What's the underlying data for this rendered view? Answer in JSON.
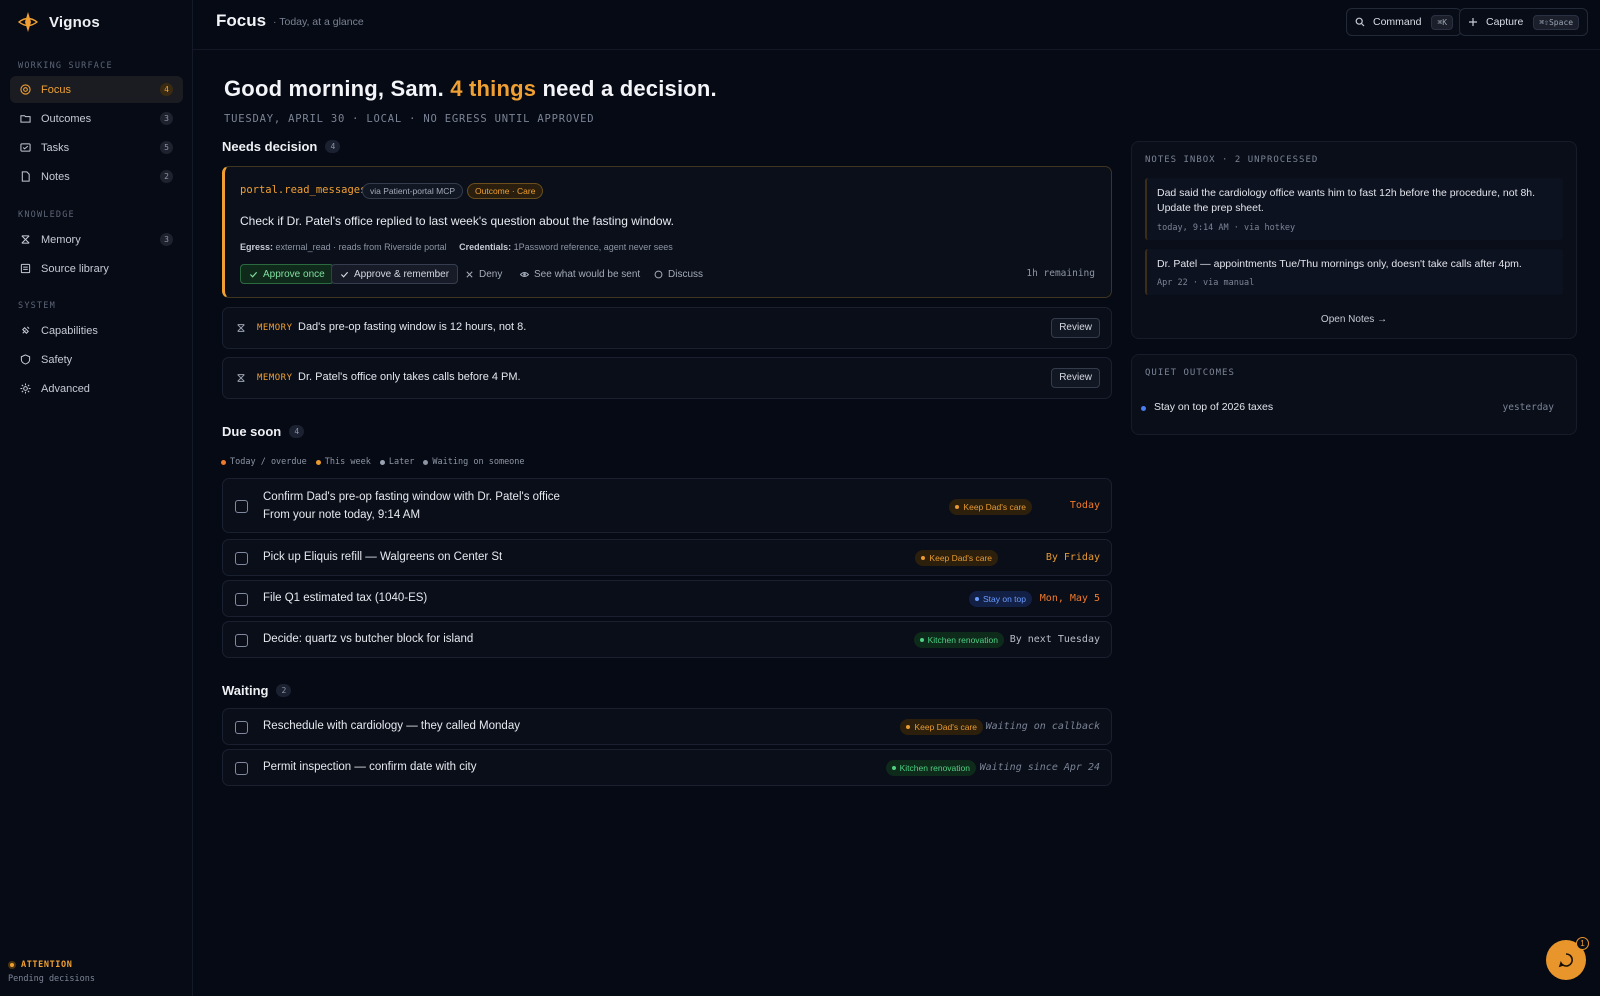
{
  "app": {
    "name": "Vignos"
  },
  "sidebar": {
    "sections": [
      {
        "label": "Working surface",
        "items": [
          {
            "label": "Focus",
            "count": "4",
            "icon": "target-icon",
            "active": true
          },
          {
            "label": "Outcomes",
            "count": "3",
            "icon": "folder-icon"
          },
          {
            "label": "Tasks",
            "count": "5",
            "icon": "checklist-icon"
          },
          {
            "label": "Notes",
            "count": "2",
            "icon": "document-icon"
          }
        ]
      },
      {
        "label": "Knowledge",
        "items": [
          {
            "label": "Memory",
            "count": "3",
            "icon": "memory-icon"
          },
          {
            "label": "Source library",
            "count": "",
            "icon": "library-icon"
          }
        ]
      },
      {
        "label": "System",
        "items": [
          {
            "label": "Capabilities",
            "count": "",
            "icon": "plug-icon"
          },
          {
            "label": "Safety",
            "count": "",
            "icon": "shield-icon"
          },
          {
            "label": "Advanced",
            "count": "",
            "icon": "gear-icon"
          }
        ]
      }
    ],
    "attention": {
      "title": "ATTENTION",
      "subtitle": "Pending decisions"
    }
  },
  "header": {
    "title": "Focus",
    "subtitle": "· Today, at a glance",
    "command": {
      "label": "Command",
      "shortcut": "⌘K"
    },
    "capture": {
      "label": "Capture",
      "shortcut": "⌘⇧Space"
    }
  },
  "greeting": {
    "prefix": "Good morning, Sam.",
    "highlight": "4 things",
    "suffix": "need a decision.",
    "dateline": "TUESDAY, APRIL 30 · LOCAL · NO EGRESS UNTIL APPROVED"
  },
  "needs_decision": {
    "title": "Needs decision",
    "count": "4",
    "primary": {
      "tool": "portal.read_messages",
      "via": "via Patient-portal MCP",
      "outcome": "Outcome · Care",
      "question": "Check if Dr. Patel's office replied to last week's question about the fasting window.",
      "egress_label": "Egress:",
      "egress_value": "external_read · reads from Riverside portal",
      "credentials_label": "Credentials:",
      "credentials_value": "1Password reference, agent never sees",
      "actions": {
        "approve_once": "Approve once",
        "approve_remember": "Approve & remember",
        "deny": "Deny",
        "preview": "See what would be sent",
        "discuss": "Discuss"
      },
      "remaining": "1h remaining"
    },
    "memories": [
      {
        "tag": "MEMORY",
        "text": "Dad's pre-op fasting window is 12 hours, not 8.",
        "action": "Review"
      },
      {
        "tag": "MEMORY",
        "text": "Dr. Patel's office only takes calls before 4 PM.",
        "action": "Review"
      }
    ]
  },
  "due_soon": {
    "title": "Due soon",
    "count": "4",
    "legend": [
      {
        "label": "Today / overdue",
        "color": "#f07a2a"
      },
      {
        "label": "This week",
        "color": "#e89a32"
      },
      {
        "label": "Later",
        "color": "#9aa2b1"
      },
      {
        "label": "Waiting on someone",
        "color": "#8d95a5"
      }
    ],
    "tasks": [
      {
        "title": "Confirm Dad's pre-op fasting window with Dr. Patel's office",
        "sub": "From your note today, 9:14 AM",
        "badge": "Keep Dad's care",
        "due": "Today"
      },
      {
        "title": "Pick up Eliquis refill — Walgreens on Center St",
        "badge": "Keep Dad's care",
        "due": "By Friday"
      },
      {
        "title": "File Q1 estimated tax (1040-ES)",
        "badge": "Stay on top",
        "due": "Mon, May 5"
      },
      {
        "title": "Decide: quartz vs butcher block for island",
        "badge": "Kitchen renovation",
        "due": "By next Tuesday"
      }
    ]
  },
  "waiting": {
    "title": "Waiting",
    "count": "2",
    "tasks": [
      {
        "title": "Reschedule with cardiology — they called Monday",
        "badge": "Keep Dad's care",
        "due": "Waiting on callback"
      },
      {
        "title": "Permit inspection — confirm date with city",
        "badge": "Kitchen renovation",
        "due": "Waiting since Apr 24"
      }
    ]
  },
  "notes_inbox": {
    "title": "NOTES INBOX · 2 UNPROCESSED",
    "notes": [
      {
        "text": "Dad said the cardiology office wants him to fast 12h before the procedure, not 8h. Update the prep sheet.",
        "meta": "today, 9:14 AM · via hotkey"
      },
      {
        "text": "Dr. Patel — appointments Tue/Thu mornings only, doesn't take calls after 4pm.",
        "meta": "Apr 22 · via manual"
      }
    ],
    "open_link": "Open Notes →"
  },
  "quiet_outcomes": {
    "title": "QUIET OUTCOMES",
    "items": [
      {
        "label": "Stay on top of 2026 taxes",
        "when": "yesterday"
      }
    ]
  },
  "help": {
    "count": "1"
  },
  "colors": {
    "accent": "#f0a033",
    "background": "#060a14"
  }
}
